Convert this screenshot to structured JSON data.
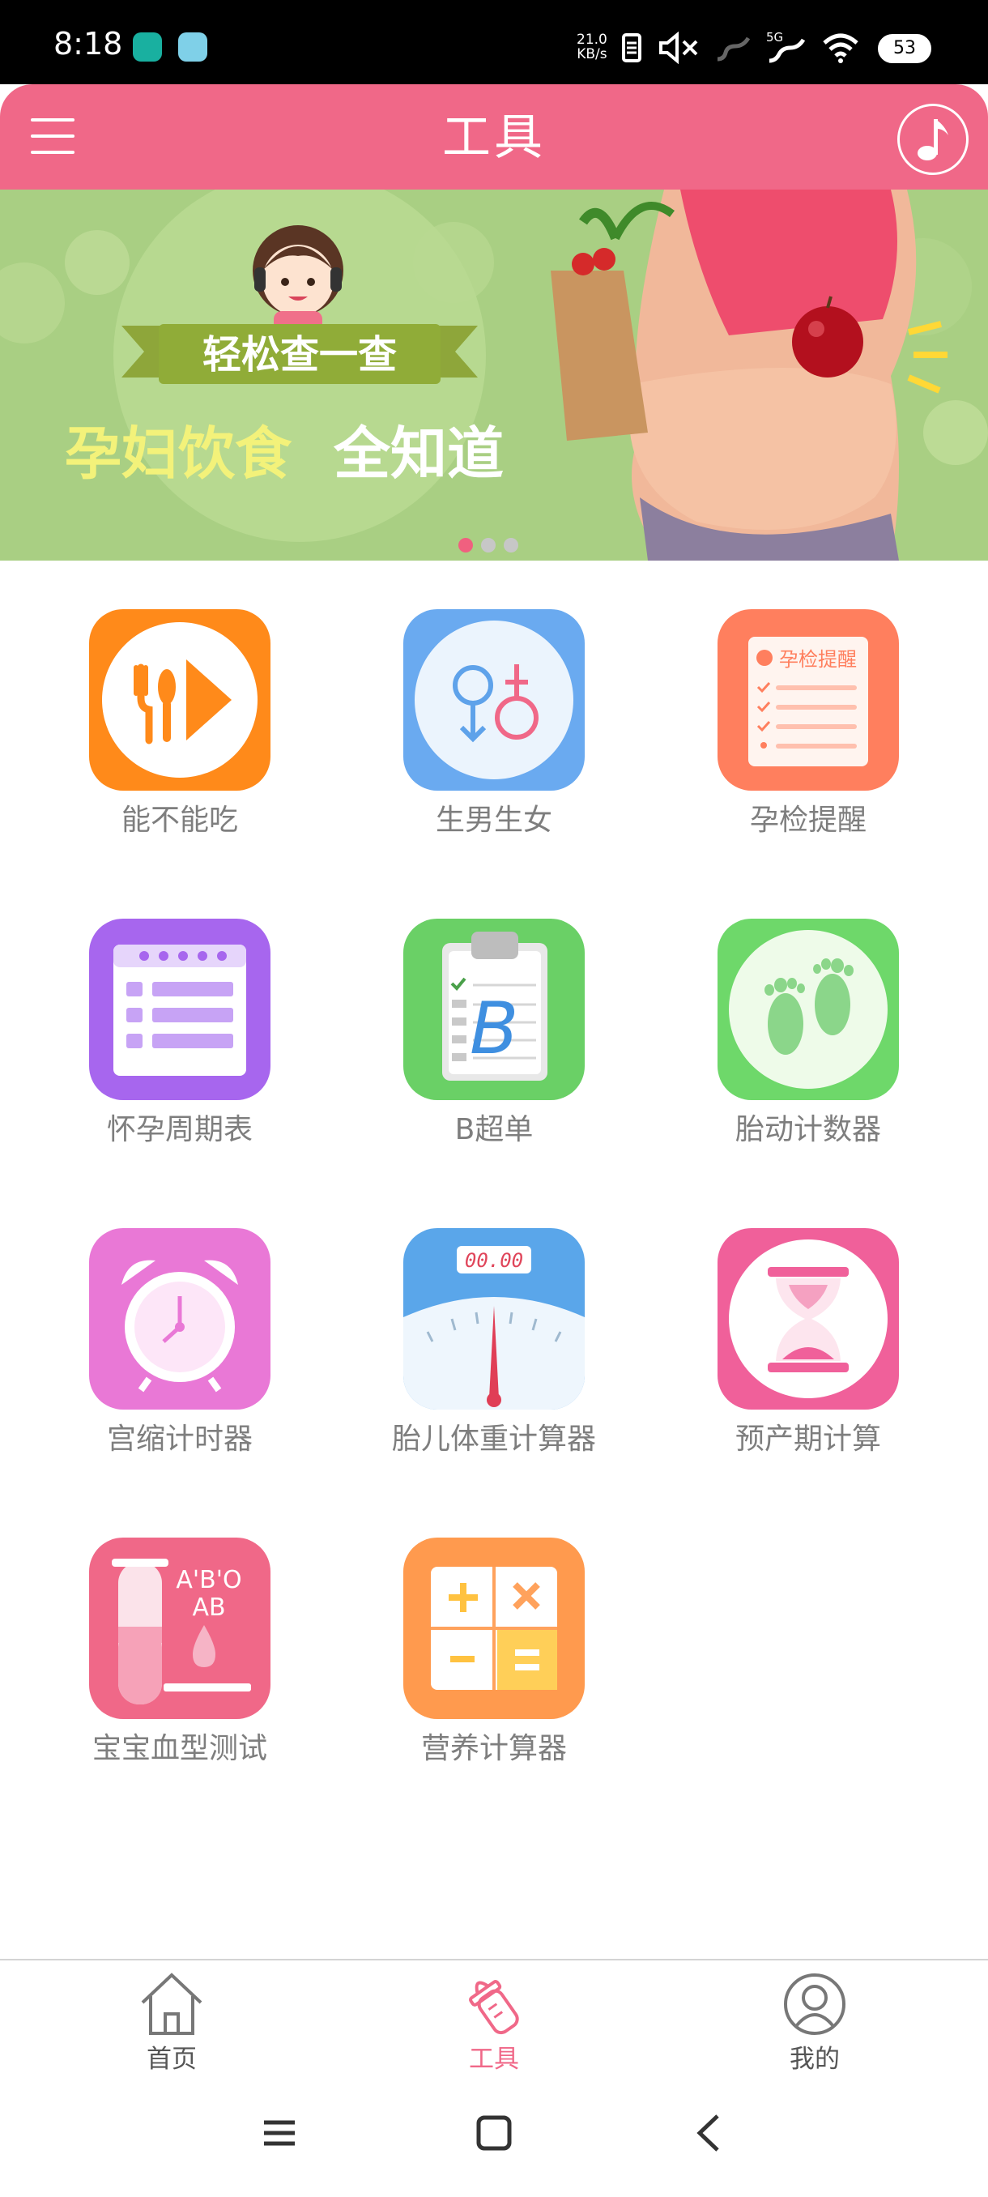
{
  "status_bar": {
    "time": "8:18",
    "net_speed_value": "21.0",
    "net_speed_unit": "KB/s",
    "network": "5G",
    "battery": "53"
  },
  "header": {
    "title": "工具"
  },
  "banner": {
    "badge_text": "轻松查一查",
    "headline_a": "孕妇饮食",
    "headline_b": "全知道",
    "slides": 3,
    "active_slide": 1
  },
  "tools": [
    {
      "label": "能不能吃",
      "icon": "utensils-play-icon",
      "color": "#ff8a1a"
    },
    {
      "label": "生男生女",
      "icon": "gender-symbols-icon",
      "color": "#6aaaf0"
    },
    {
      "label": "孕检提醒",
      "icon": "checklist-reminder-icon",
      "color": "#ff7f5e",
      "icon_text": "孕检提醒"
    },
    {
      "label": "怀孕周期表",
      "icon": "calendar-list-icon",
      "color": "#a766ee"
    },
    {
      "label": "B超单",
      "icon": "clipboard-b-icon",
      "color": "#6ad066",
      "icon_text": "B"
    },
    {
      "label": "胎动计数器",
      "icon": "footprints-icon",
      "color": "#6ed86a"
    },
    {
      "label": "宫缩计时器",
      "icon": "alarm-clock-icon",
      "color": "#e978d6"
    },
    {
      "label": "胎儿体重计算器",
      "icon": "weight-scale-icon",
      "color": "#5aa6ea",
      "icon_text": "00.00"
    },
    {
      "label": "预产期计算",
      "icon": "hourglass-icon",
      "color": "#f0609a"
    },
    {
      "label": "宝宝血型测试",
      "icon": "blood-type-tube-icon",
      "color": "#f06888",
      "icon_text_1": "A'B'O",
      "icon_text_2": "AB"
    },
    {
      "label": "营养计算器",
      "icon": "calculator-icon",
      "color": "#ff9a4e"
    }
  ],
  "bottom_nav": [
    {
      "label": "首页",
      "icon": "home-icon",
      "active": false
    },
    {
      "label": "工具",
      "icon": "baby-bottle-icon",
      "active": true
    },
    {
      "label": "我的",
      "icon": "profile-icon",
      "active": false
    }
  ],
  "colors": {
    "brand": "#f06888",
    "label_gray": "#7e7e7e"
  }
}
